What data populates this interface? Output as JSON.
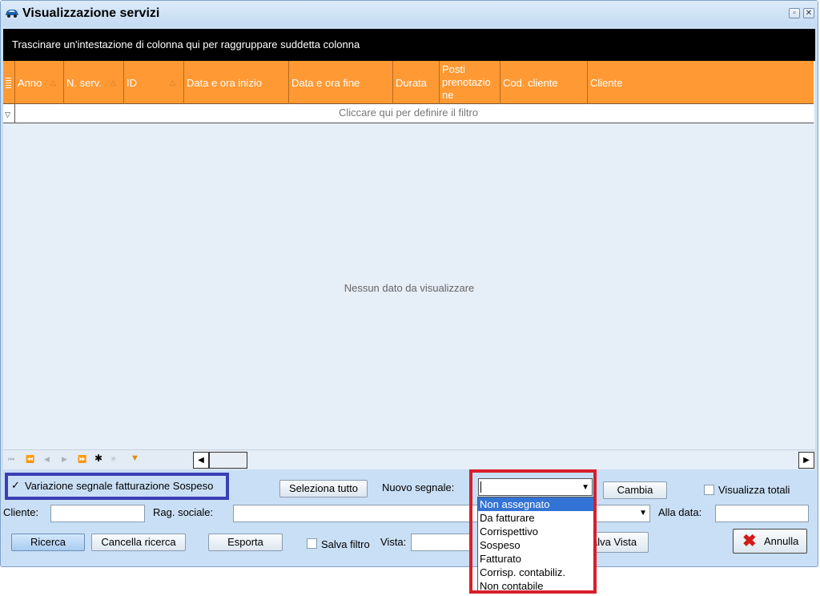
{
  "window": {
    "title": "Visualizzazione servizi",
    "restore_symbol": "▫",
    "close_symbol": "✕"
  },
  "grid": {
    "group_panel_text": "Trascinare un'intestazione di colonna qui per raggruppare suddetta colonna",
    "columns": [
      "Anno",
      "N. serv.",
      "ID",
      "Data e ora inizio",
      "Data e ora fine",
      "Durata",
      "Posti prenotazio ne",
      "Cod. cliente",
      "Cliente"
    ],
    "posti_lines": [
      "Posti",
      "prenotazio",
      "ne"
    ],
    "filter_text": "Cliccare qui per definire il filtro",
    "empty_text": "Nessun dato da visualizzare"
  },
  "controls": {
    "variazione_label": "Variazione segnale fatturazione Sospeso",
    "variazione_checked": true,
    "seleziona_tutto": "Seleziona tutto",
    "nuovo_segnale_label": "Nuovo segnale:",
    "nuovo_segnale_value": "",
    "cambia": "Cambia",
    "visualizza_totali": "Visualizza totali",
    "cliente_label": "Cliente:",
    "cliente_value": "",
    "rag_sociale_label": "Rag. sociale:",
    "rag_sociale_value": "",
    "alla_data_label": "Alla data:",
    "alla_data_value": "",
    "ricerca": "Ricerca",
    "cancella_ricerca": "Cancella ricerca",
    "esporta": "Esporta",
    "salva_filtro": "Salva filtro",
    "vista_label": "Vista:",
    "vista_value": "",
    "salva_vista": "alva Vista",
    "annulla": "Annulla"
  },
  "dropdown_options": [
    "Non assegnato",
    "Da fatturare",
    "Corrispettivo",
    "Sospeso",
    "Fatturato",
    "Corrisp. contabiliz.",
    "Non contabile"
  ],
  "dropdown_selected_index": 0,
  "colors": {
    "header_orange": "#ff9933",
    "group_panel_black": "#000000",
    "selection_blue": "#3373d6",
    "annotation_red": "#d81f2a",
    "annotation_blue": "#3b3fb5",
    "annulla_icon_red": "#d21a1a"
  }
}
